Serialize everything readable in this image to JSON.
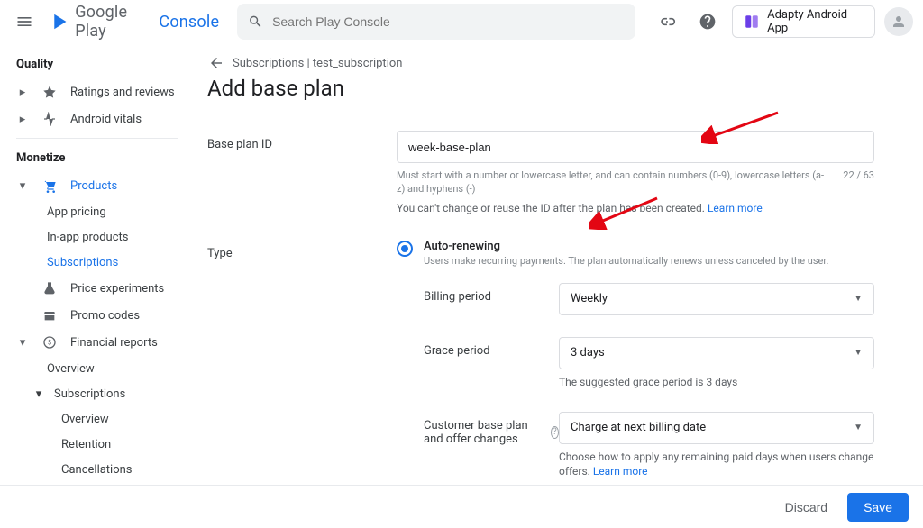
{
  "header": {
    "logo_text1": "Google Play",
    "logo_text2": "Console",
    "search_placeholder": "Search Play Console",
    "app_name": "Adapty Android App"
  },
  "sidebar": {
    "quality_heading": "Quality",
    "ratings": "Ratings and reviews",
    "vitals": "Android vitals",
    "monetize_heading": "Monetize",
    "products": "Products",
    "app_pricing": "App pricing",
    "inapp": "In-app products",
    "subscriptions": "Subscriptions",
    "price_exp": "Price experiments",
    "promo": "Promo codes",
    "financial": "Financial reports",
    "fin_overview": "Overview",
    "fin_subs": "Subscriptions",
    "fin_subs_overview": "Overview",
    "fin_subs_retention": "Retention",
    "fin_subs_cancel": "Cancellations"
  },
  "breadcrumb": {
    "text": "Subscriptions | test_subscription"
  },
  "page_title": "Add base plan",
  "form": {
    "baseplan_label": "Base plan ID",
    "baseplan_value": "week-base-plan",
    "baseplan_hint": "Must start with a number or lowercase letter, and can contain numbers (0-9), lowercase letters (a-z) and hyphens (-)",
    "baseplan_count": "22 / 63",
    "baseplan_info": "You can't change or reuse the ID after the plan has been created.",
    "learn_more": "Learn more",
    "type_label": "Type",
    "type_option": "Auto-renewing",
    "type_desc": "Users make recurring payments. The plan automatically renews unless canceled by the user.",
    "billing_label": "Billing period",
    "billing_value": "Weekly",
    "grace_label": "Grace period",
    "grace_value": "3 days",
    "grace_hint": "The suggested grace period is 3 days",
    "changes_label": "Customer base plan and offer changes",
    "changes_value": "Charge at next billing date",
    "changes_hint": "Choose how to apply any remaining paid days when users change offers."
  },
  "footer": {
    "discard": "Discard",
    "save": "Save"
  }
}
